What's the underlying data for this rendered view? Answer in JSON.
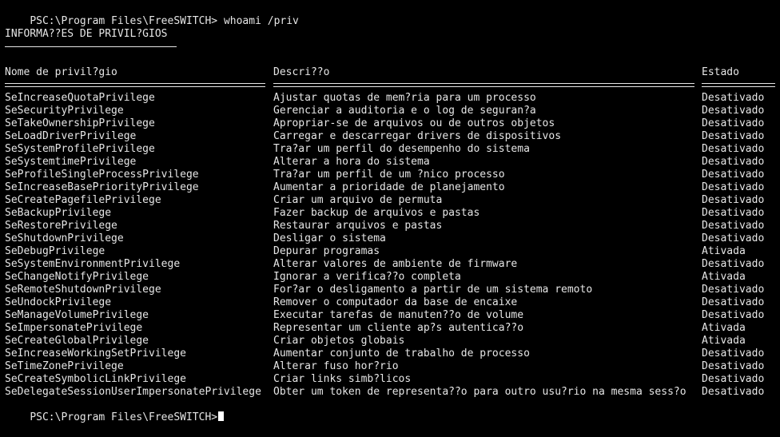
{
  "prompt_line": {
    "prompt": "PSC:\\Program Files\\FreeSWITCH>",
    "command": "whoami /priv"
  },
  "section_title": "INFORMA??ES DE PRIVIL?GIOS",
  "headers": {
    "name": "Nome de privil?gio",
    "description": "Descri??o",
    "state": "Estado"
  },
  "rows": [
    {
      "name": "SeIncreaseQuotaPrivilege",
      "description": "Ajustar quotas de mem?ria para um processo",
      "state": "Desativado"
    },
    {
      "name": "SeSecurityPrivilege",
      "description": "Gerenciar a auditoria e o log de seguran?a",
      "state": "Desativado"
    },
    {
      "name": "SeTakeOwnershipPrivilege",
      "description": "Apropriar-se de arquivos ou de outros objetos",
      "state": "Desativado"
    },
    {
      "name": "SeLoadDriverPrivilege",
      "description": "Carregar e descarregar drivers de dispositivos",
      "state": "Desativado"
    },
    {
      "name": "SeSystemProfilePrivilege",
      "description": "Tra?ar um perfil do desempenho do sistema",
      "state": "Desativado"
    },
    {
      "name": "SeSystemtimePrivilege",
      "description": "Alterar a hora do sistema",
      "state": "Desativado"
    },
    {
      "name": "SeProfileSingleProcessPrivilege",
      "description": "Tra?ar um perfil de um ?nico processo",
      "state": "Desativado"
    },
    {
      "name": "SeIncreaseBasePriorityPrivilege",
      "description": "Aumentar a prioridade de planejamento",
      "state": "Desativado"
    },
    {
      "name": "SeCreatePagefilePrivilege",
      "description": "Criar um arquivo de permuta",
      "state": "Desativado"
    },
    {
      "name": "SeBackupPrivilege",
      "description": "Fazer backup de arquivos e pastas",
      "state": "Desativado"
    },
    {
      "name": "SeRestorePrivilege",
      "description": "Restaurar arquivos e pastas",
      "state": "Desativado"
    },
    {
      "name": "SeShutdownPrivilege",
      "description": "Desligar o sistema",
      "state": "Desativado"
    },
    {
      "name": "SeDebugPrivilege",
      "description": "Depurar programas",
      "state": "Ativada"
    },
    {
      "name": "SeSystemEnvironmentPrivilege",
      "description": "Alterar valores de ambiente de firmware",
      "state": "Desativado"
    },
    {
      "name": "SeChangeNotifyPrivilege",
      "description": "Ignorar a verifica??o completa",
      "state": "Ativada"
    },
    {
      "name": "SeRemoteShutdownPrivilege",
      "description": "For?ar o desligamento a partir de um sistema remoto",
      "state": "Desativado"
    },
    {
      "name": "SeUndockPrivilege",
      "description": "Remover o computador da base de encaixe",
      "state": "Desativado"
    },
    {
      "name": "SeManageVolumePrivilege",
      "description": "Executar tarefas de manuten??o de volume",
      "state": "Desativado"
    },
    {
      "name": "SeImpersonatePrivilege",
      "description": "Representar um cliente ap?s autentica??o",
      "state": "Ativada"
    },
    {
      "name": "SeCreateGlobalPrivilege",
      "description": "Criar objetos globais",
      "state": "Ativada"
    },
    {
      "name": "SeIncreaseWorkingSetPrivilege",
      "description": "Aumentar conjunto de trabalho de processo",
      "state": "Desativado"
    },
    {
      "name": "SeTimeZonePrivilege",
      "description": "Alterar fuso hor?rio",
      "state": "Desativado"
    },
    {
      "name": "SeCreateSymbolicLinkPrivilege",
      "description": "Criar links simb?licos",
      "state": "Desativado"
    },
    {
      "name": "SeDelegateSessionUserImpersonatePrivilege",
      "description": "Obter um token de representa??o para outro usu?rio na mesma sess?o",
      "state": "Desativado"
    }
  ],
  "final_prompt": "PSC:\\Program Files\\FreeSWITCH>",
  "colors": {
    "background": "#000000",
    "foreground": "#e6e6e6"
  }
}
